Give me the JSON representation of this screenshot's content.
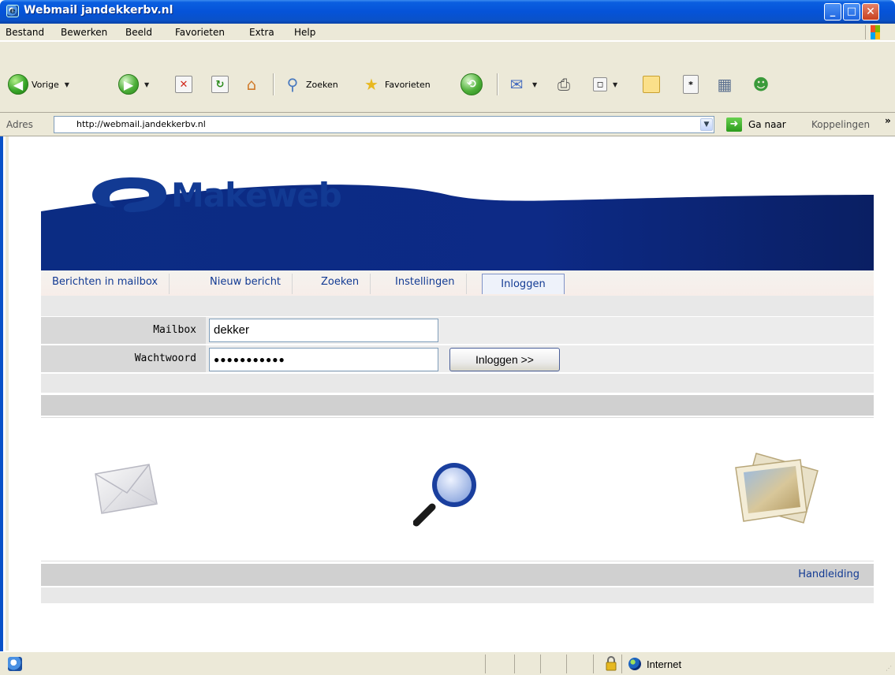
{
  "window": {
    "title": "Webmail jandekkerbv.nl"
  },
  "menu": {
    "items": [
      {
        "label": "Bestand"
      },
      {
        "label": "Bewerken"
      },
      {
        "label": "Beeld"
      },
      {
        "label": "Favorieten"
      },
      {
        "label": "Extra"
      },
      {
        "label": "Help"
      }
    ]
  },
  "toolbar": {
    "back_label": "Vorige",
    "search_label": "Zoeken",
    "favorites_label": "Favorieten"
  },
  "address": {
    "label": "Adres",
    "url": "http://webmail.jandekkerbv.nl",
    "go_label": "Ga naar",
    "links_label": "Koppelingen"
  },
  "page": {
    "logo_text": "Makeweb",
    "brand_color": "#123a93",
    "nav_tabs": [
      {
        "label": "Berichten in mailbox"
      },
      {
        "label": "Nieuw bericht"
      },
      {
        "label": "Zoeken"
      },
      {
        "label": "Instellingen"
      },
      {
        "label": "Inloggen",
        "active": true
      }
    ],
    "login": {
      "mailbox_label": "Mailbox",
      "mailbox_value": "dekker",
      "password_label": "Wachtwoord",
      "password_value": "●●●●●●●●●●●",
      "submit_label": "Inloggen >>"
    },
    "footer_link": "Handleiding"
  },
  "status": {
    "zone": "Internet"
  }
}
